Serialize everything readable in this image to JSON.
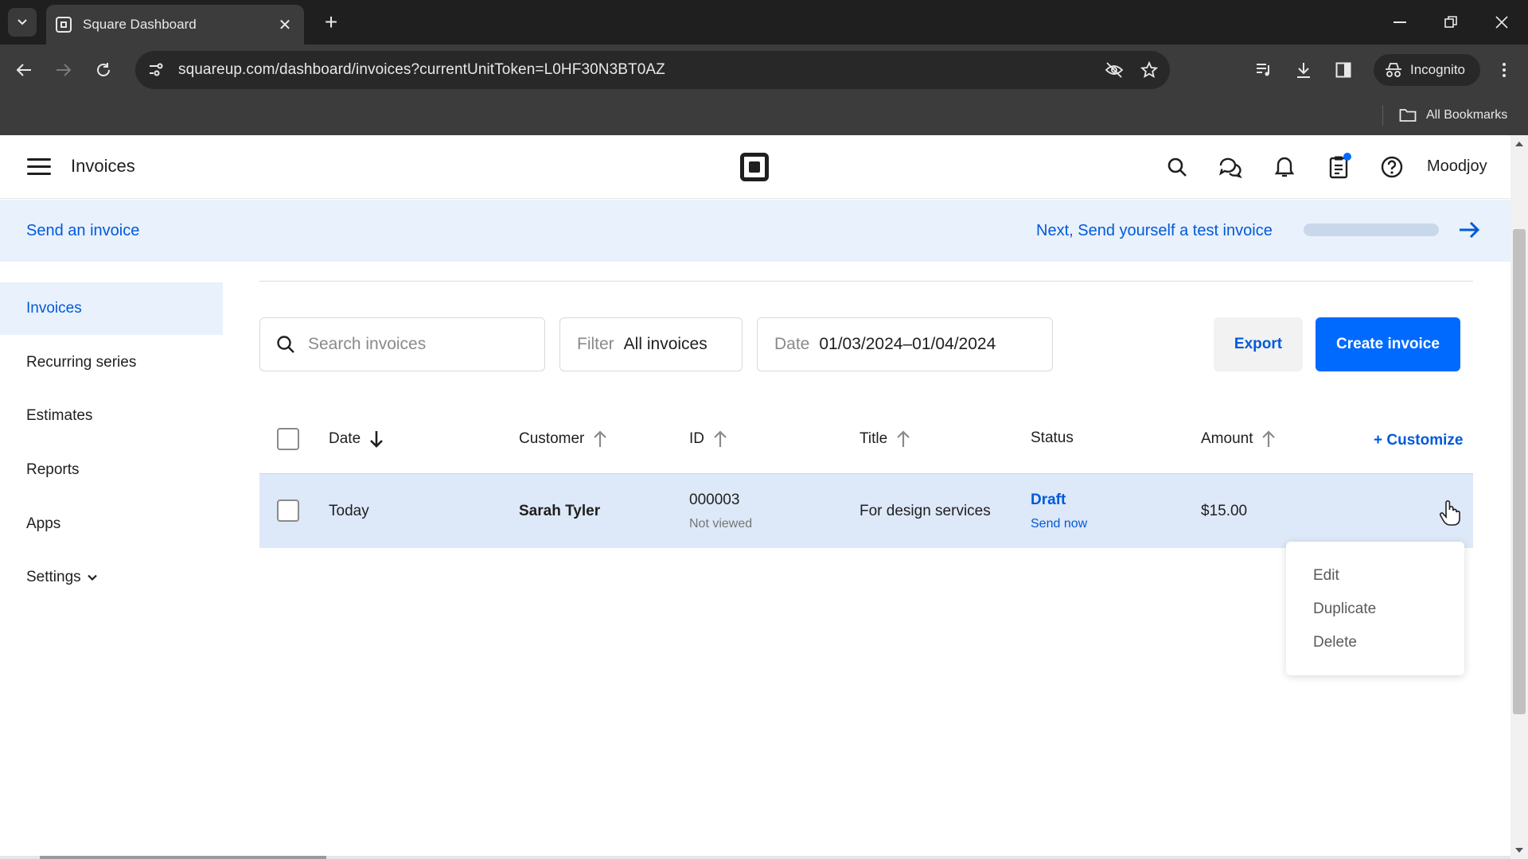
{
  "browser": {
    "tab_title": "Square Dashboard",
    "url": "squareup.com/dashboard/invoices?currentUnitToken=L0HF30N3BT0AZ",
    "incognito_label": "Incognito",
    "bookmarks_label": "All Bookmarks"
  },
  "header": {
    "title": "Invoices",
    "user_name": "Moodjoy"
  },
  "banner": {
    "left_text": "Send an invoice",
    "next_text": "Next, Send yourself a test invoice",
    "progress": 0.0
  },
  "sidebar": {
    "items": [
      {
        "label": "Invoices",
        "active": true
      },
      {
        "label": "Recurring series"
      },
      {
        "label": "Estimates"
      },
      {
        "label": "Reports"
      },
      {
        "label": "Apps"
      },
      {
        "label": "Settings"
      }
    ]
  },
  "controls": {
    "search_placeholder": "Search invoices",
    "filter_label": "Filter",
    "filter_value": "All invoices",
    "date_label": "Date",
    "date_value": "01/03/2024–01/04/2024",
    "export_label": "Export",
    "create_label": "Create invoice"
  },
  "table": {
    "columns": [
      "Date",
      "Customer",
      "ID",
      "Title",
      "Status",
      "Amount"
    ],
    "customize_label": "+ Customize",
    "rows": [
      {
        "date": "Today",
        "customer": "Sarah Tyler",
        "id": "000003",
        "id_sub": "Not viewed",
        "title": "For design services",
        "status": "Draft",
        "status_action": "Send now",
        "amount": "$15.00"
      }
    ]
  },
  "context_menu": {
    "items": [
      "Edit",
      "Duplicate",
      "Delete"
    ]
  },
  "colors": {
    "accent": "#006aff",
    "link": "#005ad9",
    "banner_bg": "#e9f1fc",
    "row_highlight": "#dde8f8"
  }
}
